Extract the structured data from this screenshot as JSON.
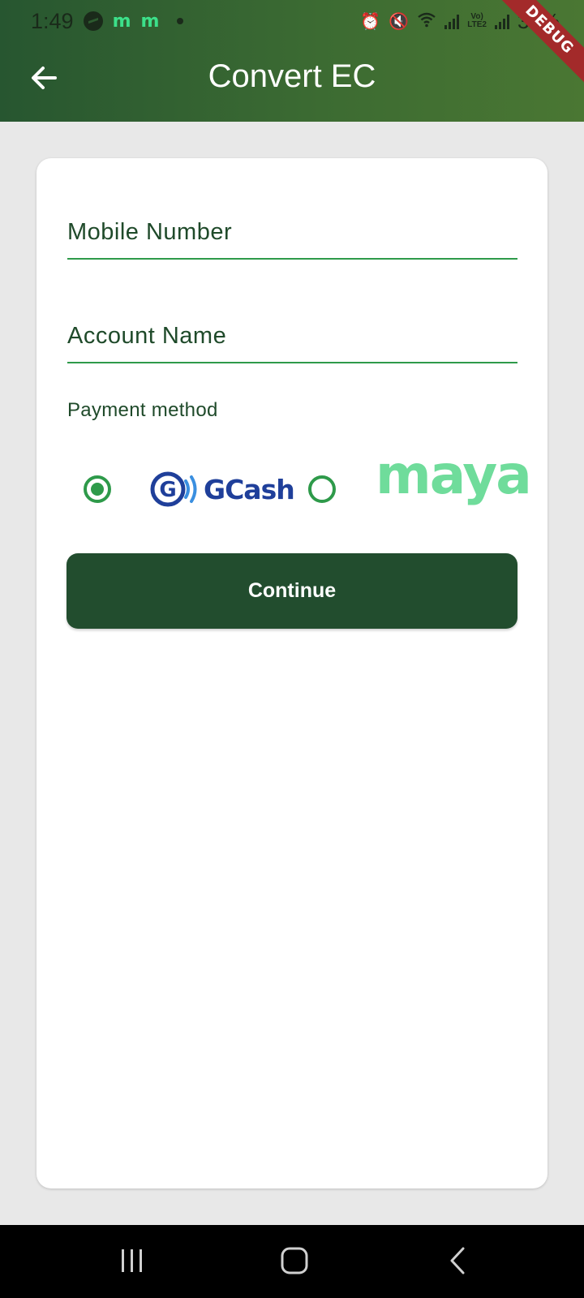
{
  "status_bar": {
    "time": "1:49",
    "notif_m1": "m",
    "notif_m2": "m",
    "lte_label": "Vo)\nLTE2",
    "battery": "34%",
    "debug_ribbon": "DEBUG"
  },
  "app_bar": {
    "title": "Convert EC",
    "back_icon": "arrow-left-icon"
  },
  "form": {
    "mobile_number": {
      "placeholder": "Mobile Number",
      "value": ""
    },
    "account_name": {
      "placeholder": "Account Name",
      "value": ""
    },
    "payment_method_label": "Payment method",
    "payment_options": [
      {
        "name": "gcash",
        "logo_text": "GCash",
        "selected": true
      },
      {
        "name": "maya",
        "logo_text": "maya",
        "selected": false
      }
    ],
    "continue_label": "Continue"
  },
  "colors": {
    "header_gradient_start": "#275630",
    "header_gradient_end": "#4a7733",
    "accent_green": "#2e9a4a",
    "button_green": "#224d2e",
    "gcash_blue": "#1f3f9a",
    "maya_green": "#6fdc9b",
    "debug_red": "#a32a2a"
  },
  "nav_bar": {
    "icons": [
      "recents-icon",
      "home-icon",
      "back-icon"
    ]
  }
}
